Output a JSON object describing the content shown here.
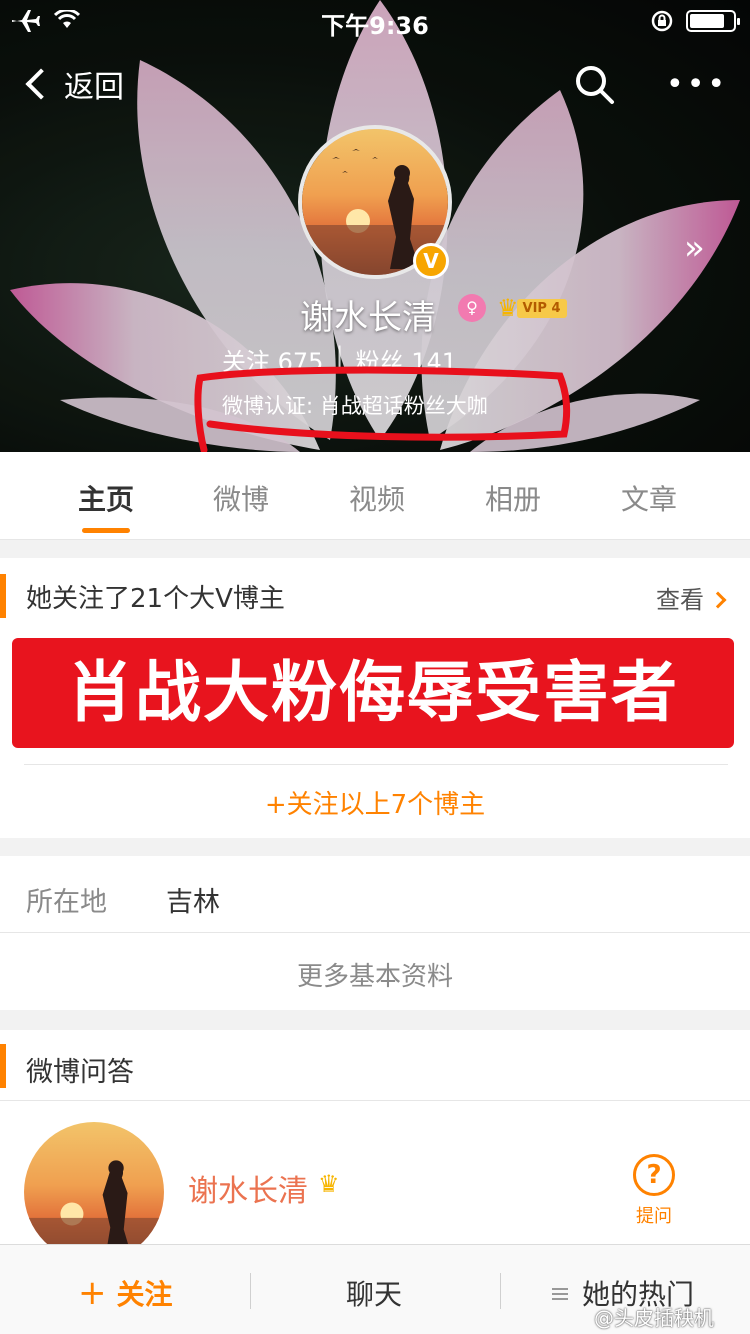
{
  "status_bar": {
    "time": "下午9:36"
  },
  "nav": {
    "back_label": "返回"
  },
  "profile": {
    "name": "谢水长清",
    "vip_label": "VIP 4",
    "verified_badge": "V",
    "following_label": "关注",
    "following_count": "675",
    "followers_label": "粉丝",
    "followers_count": "141",
    "verification": "微博认证: 肖战超话粉丝大咖"
  },
  "tabs": [
    {
      "label": "主页"
    },
    {
      "label": "微博"
    },
    {
      "label": "视频"
    },
    {
      "label": "相册"
    },
    {
      "label": "文章"
    }
  ],
  "followed_card": {
    "title": "她关注了21个大V博主",
    "view_label": "查看",
    "overlay_text": "肖战大粉侮辱受害者",
    "follow_all_label": "+关注以上7个博主"
  },
  "info_card": {
    "location_label": "所在地",
    "location_value": "吉林",
    "more_label": "更多基本资料"
  },
  "qa_card": {
    "title": "微博问答",
    "name": "谢水长清",
    "ask_label": "提问"
  },
  "bottom_bar": {
    "follow_label": "关注",
    "chat_label": "聊天",
    "hot_label": "她的热门"
  },
  "watermark": "@头皮插秧机",
  "colors": {
    "accent": "#ff8200",
    "banner_red": "#e8141e",
    "name_orange": "#eb7350",
    "verified": "#f7a500"
  }
}
